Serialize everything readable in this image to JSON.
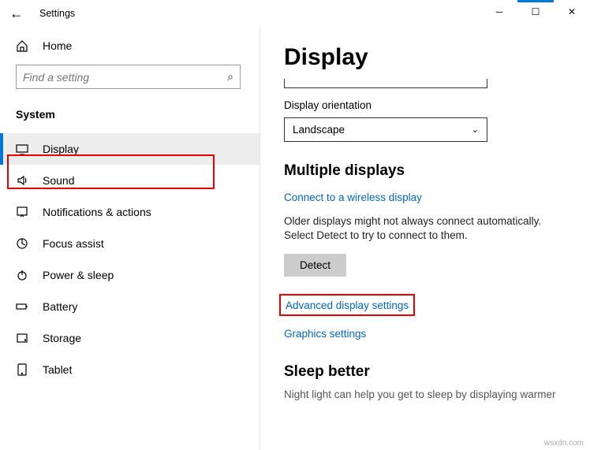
{
  "window": {
    "title": "Settings"
  },
  "sidebar": {
    "home_label": "Home",
    "search_placeholder": "Find a setting",
    "category": "System",
    "items": [
      {
        "label": "Display"
      },
      {
        "label": "Sound"
      },
      {
        "label": "Notifications & actions"
      },
      {
        "label": "Focus assist"
      },
      {
        "label": "Power & sleep"
      },
      {
        "label": "Battery"
      },
      {
        "label": "Storage"
      },
      {
        "label": "Tablet"
      }
    ]
  },
  "main": {
    "page_title": "Display",
    "orientation_label": "Display orientation",
    "orientation_value": "Landscape",
    "multi_heading": "Multiple displays",
    "wireless_link": "Connect to a wireless display",
    "older_text": "Older displays might not always connect automatically. Select Detect to try to connect to them.",
    "detect_btn": "Detect",
    "advanced_link": "Advanced display settings",
    "graphics_link": "Graphics settings",
    "sleep_heading": "Sleep better",
    "sleep_desc": "Night light can help you get to sleep by displaying warmer"
  },
  "watermark": "wsxdn.com"
}
